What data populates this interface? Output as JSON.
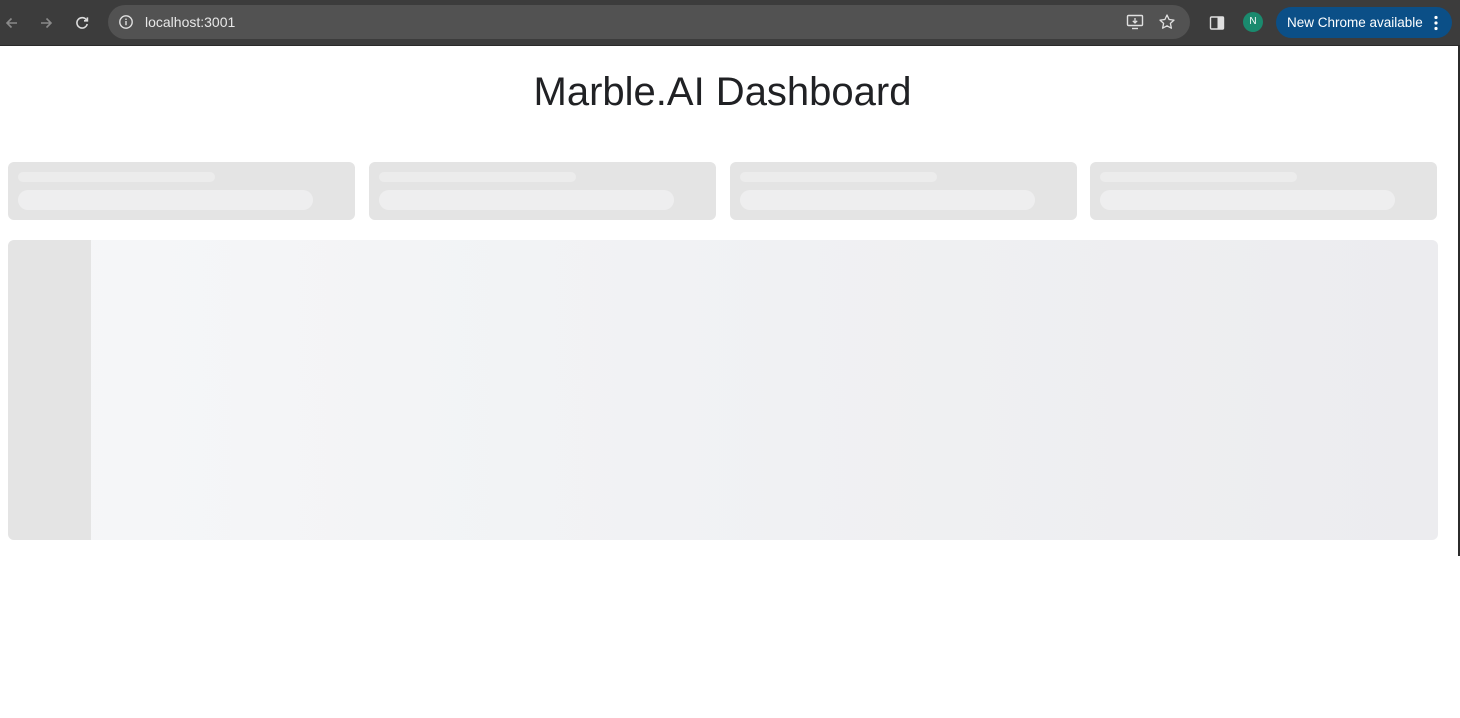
{
  "browser": {
    "url": "localhost:3001",
    "profile_initial": "N",
    "update_label": "New Chrome available",
    "icons": {
      "back": "arrow-left-icon",
      "forward": "arrow-right-icon",
      "reload": "reload-icon",
      "site_info": "info-icon",
      "install": "install-app-icon",
      "bookmark": "star-icon",
      "side_panel": "side-panel-icon",
      "menu": "kebab-menu-icon"
    },
    "colors": {
      "toolbar": "#3c3c3c",
      "omnibox": "#525252",
      "avatar": "#1a8a6e",
      "update_pill": "#0b4f87"
    }
  },
  "page": {
    "title": "Marble.AI Dashboard",
    "stat_cards_count": 4,
    "colors": {
      "skeleton": "#e4e4e4",
      "skeleton_line": "#ececec",
      "title": "#202124"
    }
  }
}
